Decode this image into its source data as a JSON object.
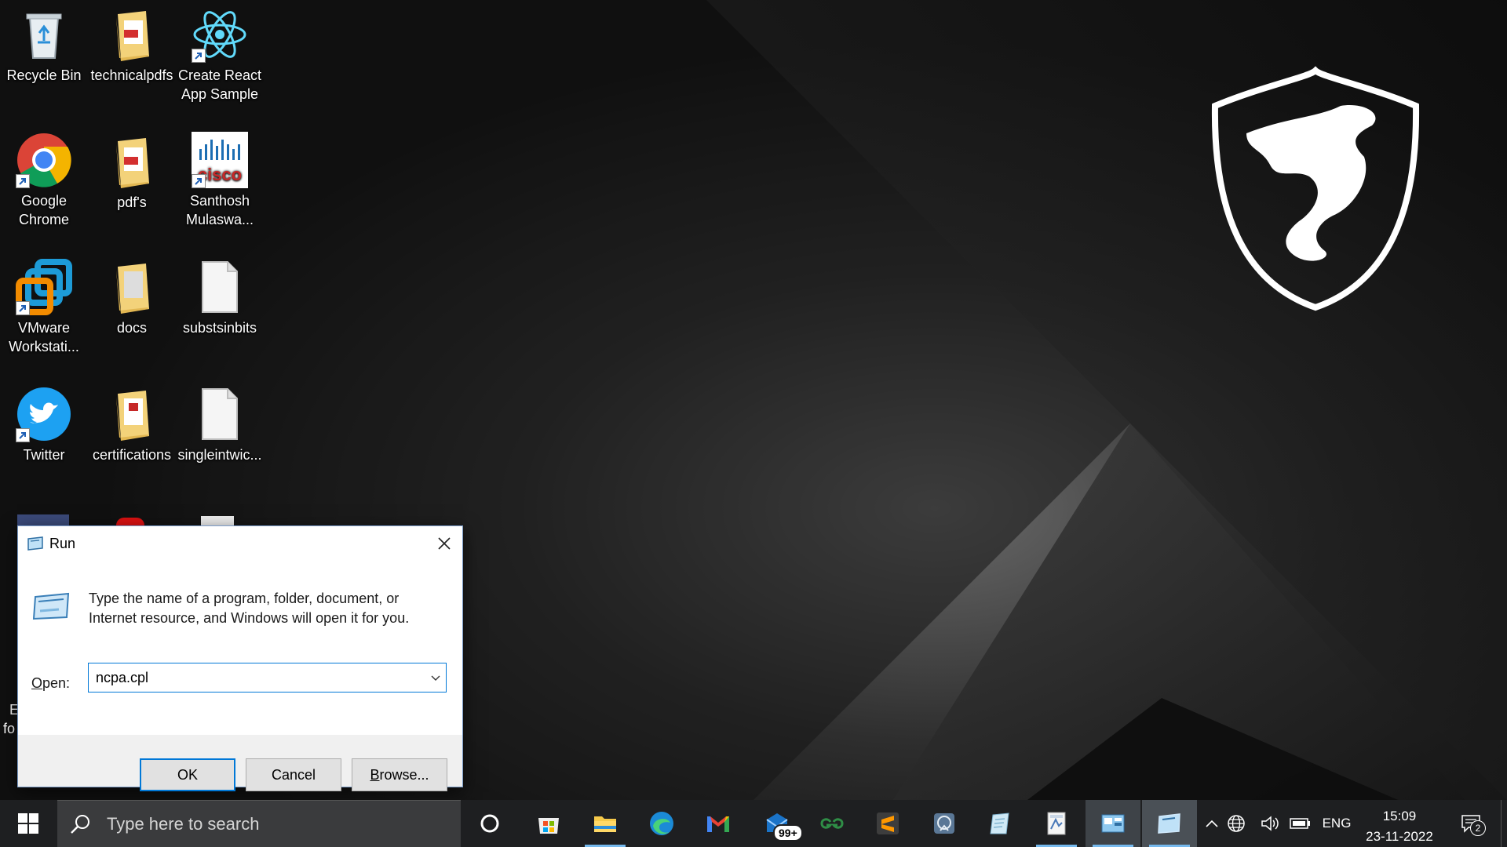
{
  "desktop": {
    "icons": [
      {
        "id": "recycle-bin",
        "label_line1": "Recycle Bin",
        "label_line2": "",
        "icon": "recycle-bin-icon"
      },
      {
        "id": "technicalpdfs",
        "label_line1": "technicalpdfs",
        "label_line2": "",
        "icon": "pdf-folder-icon"
      },
      {
        "id": "create-react",
        "label_line1": "Create React",
        "label_line2": "App Sample",
        "icon": "react-icon"
      },
      {
        "id": "google-chrome",
        "label_line1": "Google",
        "label_line2": "Chrome",
        "icon": "chrome-icon"
      },
      {
        "id": "pdfs",
        "label_line1": "pdf's",
        "label_line2": "",
        "icon": "pdf-folder-icon"
      },
      {
        "id": "santhosh",
        "label_line1": "Santhosh",
        "label_line2": "Mulaswa...",
        "icon": "cisco-icon"
      },
      {
        "id": "vmware",
        "label_line1": "VMware",
        "label_line2": "Workstati...",
        "icon": "vmware-icon"
      },
      {
        "id": "docs",
        "label_line1": "docs",
        "label_line2": "",
        "icon": "folder-icon"
      },
      {
        "id": "substsinbits",
        "label_line1": "substsinbits",
        "label_line2": "",
        "icon": "file-icon"
      },
      {
        "id": "twitter",
        "label_line1": "Twitter",
        "label_line2": "",
        "icon": "twitter-icon"
      },
      {
        "id": "certifications",
        "label_line1": "certifications",
        "label_line2": "",
        "icon": "folder-icon"
      },
      {
        "id": "singleintwic",
        "label_line1": "singleintwic...",
        "label_line2": "",
        "icon": "file-icon"
      }
    ],
    "partial_labels": {
      "left_e": "E",
      "left_fo": "fo"
    }
  },
  "run_dialog": {
    "title": "Run",
    "description_line1": "Type the name of a program, folder, document, or",
    "description_line2": "Internet resource, and Windows will open it for you.",
    "open_label_prefix": "O",
    "open_label_rest": "pen:",
    "input_value": "ncpa.cpl",
    "ok_label": "OK",
    "cancel_label": "Cancel",
    "browse_label_prefix": "B",
    "browse_label_rest": "rowse..."
  },
  "taskbar": {
    "search_placeholder": "Type here to search",
    "apps": [
      "cortana-icon",
      "microsoft-store-icon",
      "file-explorer-icon",
      "edge-icon",
      "gmail-icon",
      "mail-icon",
      "geeksforgeeks-icon",
      "sublime-text-icon",
      "photos-icon",
      "notepad-icon",
      "pdf-app-icon",
      "control-panel-icon",
      "run-icon"
    ],
    "mail_badge": "99+",
    "tray": {
      "language": "ENG",
      "time": "15:09",
      "date": "23-11-2022",
      "notification_count": "2"
    }
  }
}
